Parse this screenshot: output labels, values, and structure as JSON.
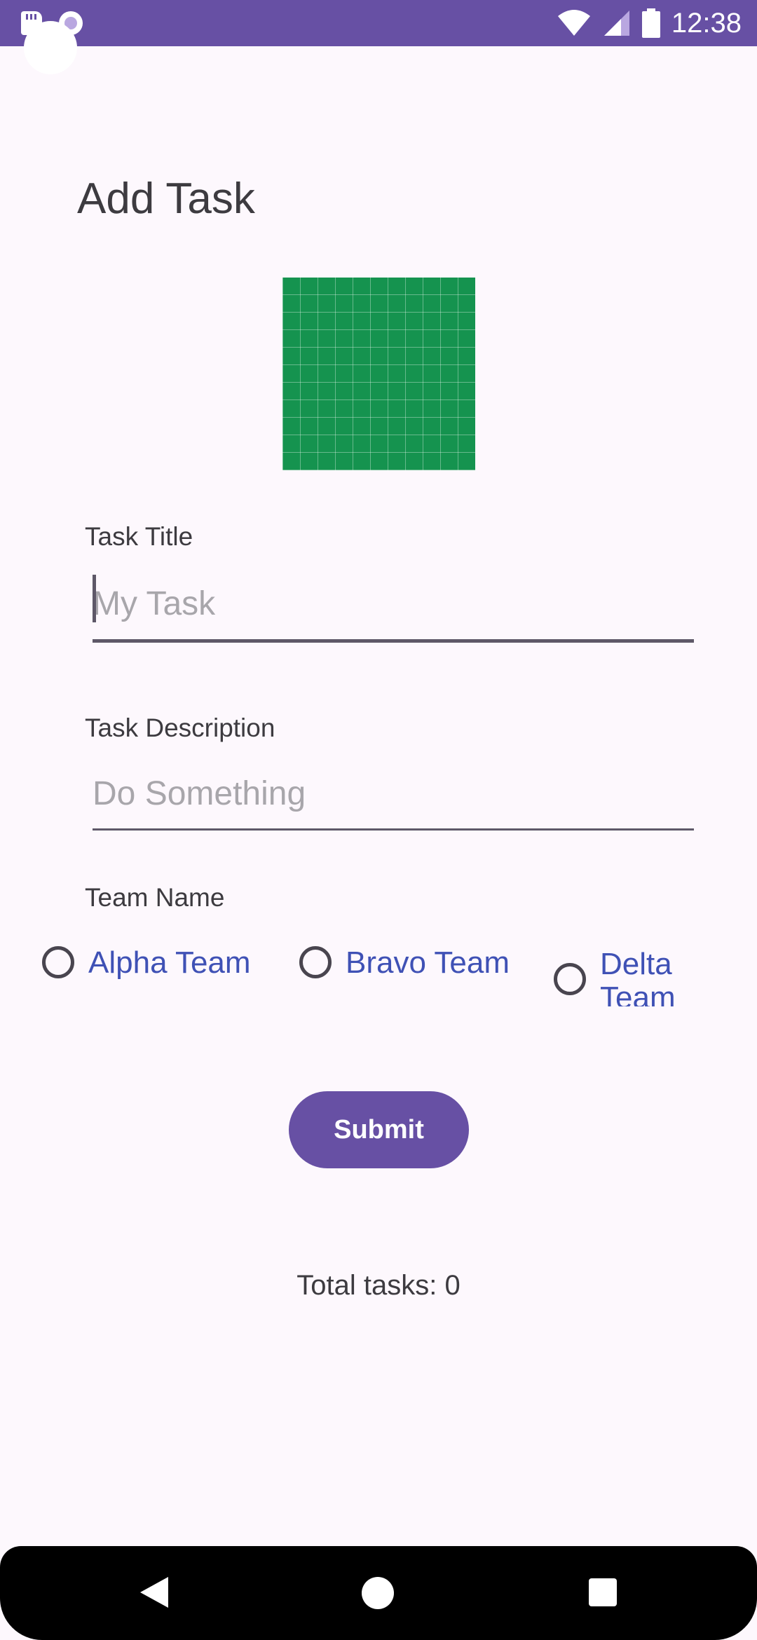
{
  "status_bar": {
    "time": "12:38",
    "icons": [
      "sd-card-icon",
      "screen-record-icon",
      "wifi-icon",
      "cell-signal-icon",
      "battery-icon"
    ],
    "color": "#6750a4"
  },
  "page": {
    "title": "Add Task",
    "image_icon": "task-image-placeholder",
    "image_color": "#15934f"
  },
  "form": {
    "task_title_label": "Task Title",
    "task_title_placeholder": "My Task",
    "task_title_value": "",
    "task_description_label": "Task Description",
    "task_description_placeholder": "Do Something",
    "task_description_value": "",
    "team_name_label": "Team Name",
    "teams": [
      {
        "label": "Alpha Team",
        "selected": false
      },
      {
        "label": "Bravo Team",
        "selected": false
      },
      {
        "label": "Delta Team",
        "selected": false
      }
    ],
    "submit_label": "Submit"
  },
  "footer": {
    "total_tasks": "Total tasks: 0"
  },
  "nav_bar": {
    "icons": [
      "back-icon",
      "home-icon",
      "recents-icon"
    ]
  },
  "colors": {
    "accent": "#6750a4",
    "radio_label": "#3f51b5",
    "background": "#fdf8fd"
  }
}
